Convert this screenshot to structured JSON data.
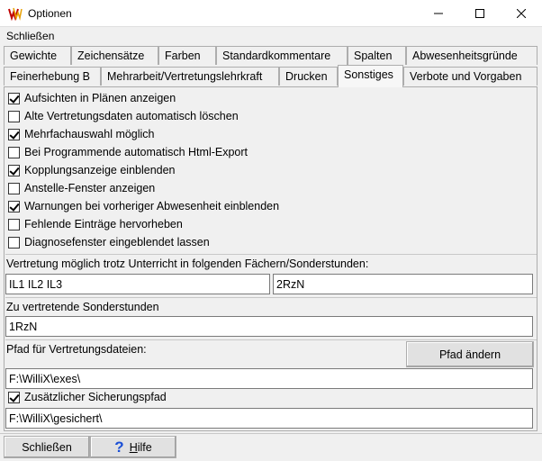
{
  "window": {
    "title": "Optionen"
  },
  "menubar": {
    "close_label": "Schließen"
  },
  "tabs": [
    {
      "label": "Gewichte"
    },
    {
      "label": "Zeichensätze"
    },
    {
      "label": "Farben"
    },
    {
      "label": "Standardkommentare"
    },
    {
      "label": "Spalten"
    },
    {
      "label": "Abwesenheitsgründe"
    },
    {
      "label": "Feinerhebung B"
    },
    {
      "label": "Mehrarbeit/Vertretungslehrkraft"
    },
    {
      "label": "Drucken"
    },
    {
      "label": "Sonstiges",
      "active": true
    },
    {
      "label": "Verbote und Vorgaben"
    }
  ],
  "options": [
    {
      "label": "Aufsichten in Plänen anzeigen",
      "checked": true
    },
    {
      "label": "Alte Vertretungsdaten automatisch löschen",
      "checked": false
    },
    {
      "label": "Mehrfachauswahl möglich",
      "checked": true
    },
    {
      "label": "Bei Programmende automatisch Html-Export",
      "checked": false
    },
    {
      "label": "Kopplungsanzeige einblenden",
      "checked": true
    },
    {
      "label": "Anstelle-Fenster anzeigen",
      "checked": false
    },
    {
      "label": "Warnungen bei vorheriger Abwesenheit einblenden",
      "checked": true
    },
    {
      "label": "Fehlende Einträge hervorheben",
      "checked": false
    },
    {
      "label": "Diagnosefenster eingeblendet lassen",
      "checked": false
    }
  ],
  "vertretung": {
    "label": "Vertretung möglich trotz Unterricht in folgenden Fächern/Sonderstunden:",
    "field1_value": "IL1  IL2  IL3",
    "field2_value": "2RzN"
  },
  "sonderstunden": {
    "label": "Zu vertretende Sonderstunden",
    "value": "1RzN"
  },
  "pfad": {
    "label": "Pfad für Vertretungsdateien:",
    "change_button": "Pfad ändern",
    "value": "F:\\WilliX\\exes\\"
  },
  "sicherung": {
    "label": "Zusätzlicher Sicherungspfad",
    "checked": true,
    "value": "F:\\WilliX\\gesichert\\"
  },
  "footer": {
    "close_button": "Schließen",
    "help_h": "H",
    "help_rest": "ilfe"
  },
  "colors": {
    "help_icon": "#1a4fd6",
    "app_icon": "#c00000"
  }
}
